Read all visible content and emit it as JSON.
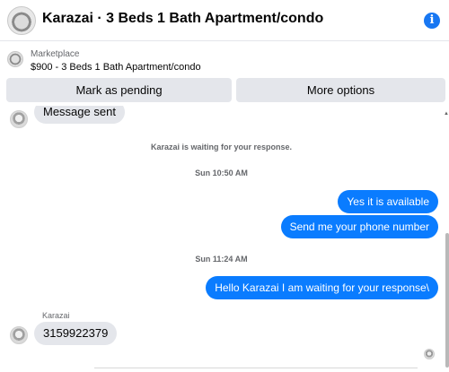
{
  "header": {
    "title": "Karazai · 3 Beds 1 Bath Apartment/condo",
    "info_icon": "info-icon"
  },
  "listing": {
    "label": "Marketplace",
    "summary": "$900 - 3 Beds 1 Bath Apartment/condo"
  },
  "actions": {
    "mark_pending": "Mark as pending",
    "more_options": "More options"
  },
  "messages": {
    "first_incoming": "Message sent",
    "waiting_notice": "Karazai is waiting for your response.",
    "time_1": "Sun 10:50 AM",
    "out_1": "Yes it is available",
    "out_2": "Send me your phone number",
    "time_2": "Sun 11:24 AM",
    "out_3": "Hello Karazai I am waiting for your response\\",
    "sender_name": "Karazai",
    "in_2": "3159922379"
  },
  "colors": {
    "accent": "#0a7cff",
    "incoming_bubble": "#e4e6eb"
  }
}
